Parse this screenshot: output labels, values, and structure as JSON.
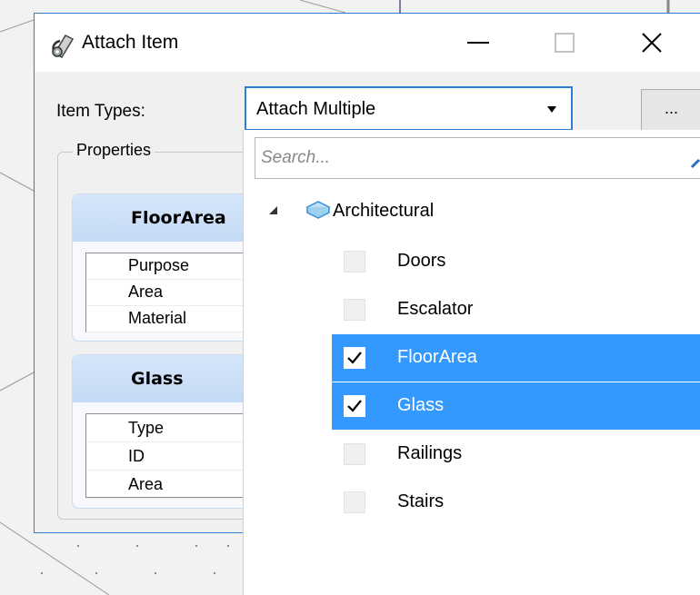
{
  "window": {
    "title": "Attach Item",
    "controls": {
      "minimize": "minimize",
      "maximize": "maximize",
      "close": "close"
    }
  },
  "item_types": {
    "label": "Item Types:",
    "selected": "Attach Multiple",
    "more_label": "..."
  },
  "properties": {
    "label": "Properties",
    "cards": [
      {
        "title": "FloorArea",
        "fields": [
          "Purpose",
          "Area",
          "Material"
        ]
      },
      {
        "title": "Glass",
        "fields": [
          "Type",
          "ID",
          "Area"
        ]
      }
    ]
  },
  "dropdown": {
    "search_placeholder": "Search...",
    "root": {
      "label": "Architectural",
      "expanded": true
    },
    "items": [
      {
        "label": "Doors",
        "checked": false,
        "selected": false
      },
      {
        "label": "Escalator",
        "checked": false,
        "selected": false
      },
      {
        "label": "FloorArea",
        "checked": true,
        "selected": true
      },
      {
        "label": "Glass",
        "checked": true,
        "selected": true
      },
      {
        "label": "Railings",
        "checked": false,
        "selected": false
      },
      {
        "label": "Stairs",
        "checked": false,
        "selected": false
      }
    ]
  },
  "colors": {
    "accent": "#2b7fd1",
    "selection": "#3399ff",
    "card_header": "#c4daf5"
  }
}
